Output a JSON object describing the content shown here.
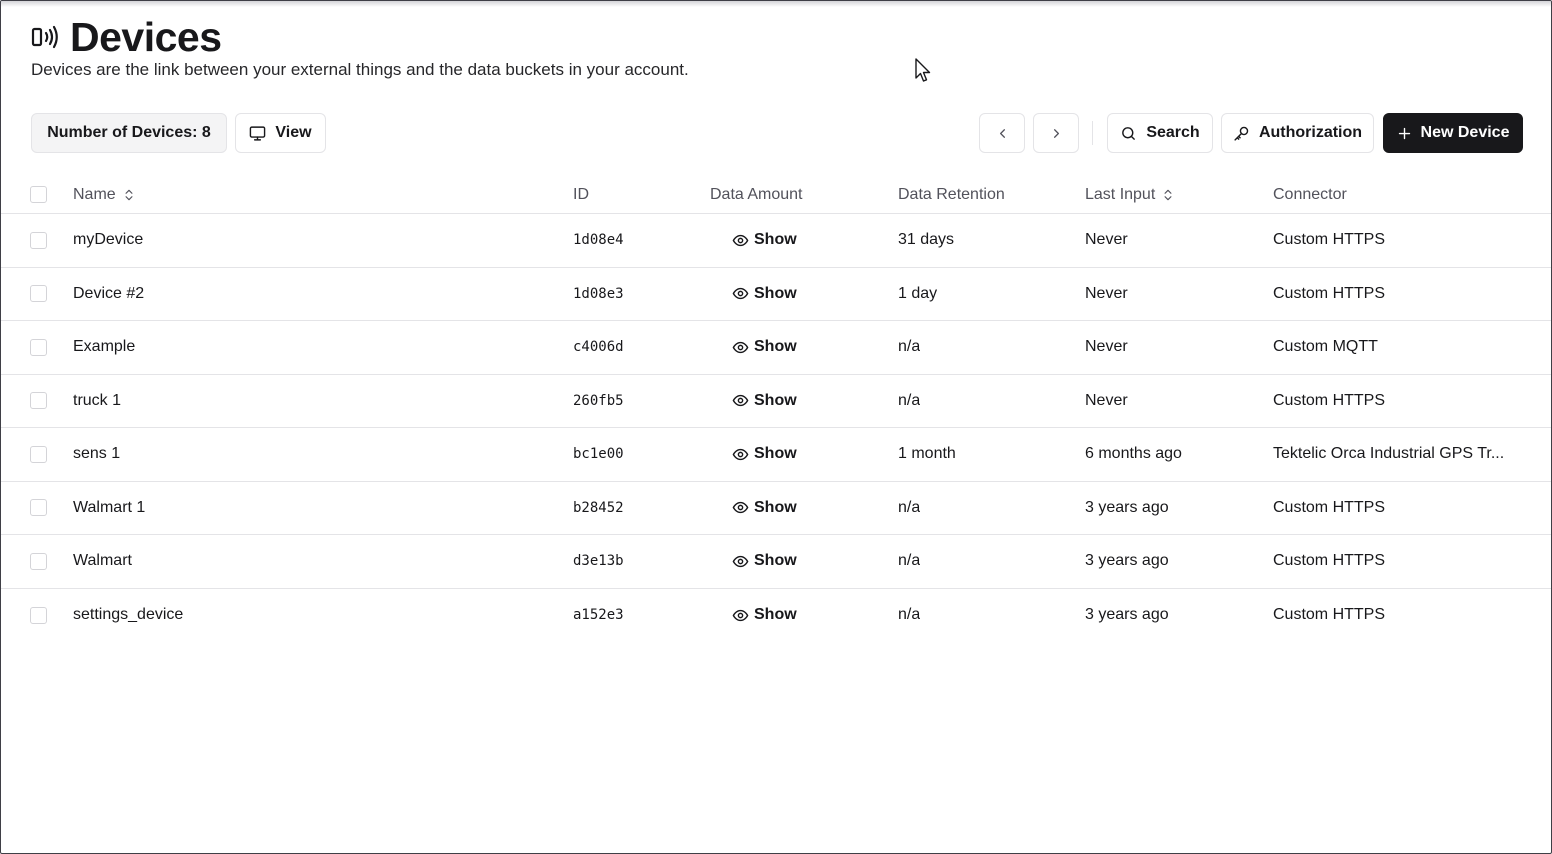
{
  "page": {
    "title": "Devices",
    "subtitle": "Devices are the link between your external things and the data buckets in your account.",
    "title_icon": "device-signal-icon"
  },
  "toolbar": {
    "count_label": "Number of Devices: 8",
    "view_label": "View",
    "search_label": "Search",
    "authorization_label": "Authorization",
    "new_device_label": "New Device"
  },
  "table": {
    "columns": {
      "name": "Name",
      "id": "ID",
      "amount": "Data Amount",
      "retention": "Data Retention",
      "last": "Last Input",
      "connector": "Connector"
    },
    "show_label": "Show",
    "rows": [
      {
        "name": "myDevice",
        "id": "1d08e4",
        "retention": "31 days",
        "last": "Never",
        "connector": "Custom HTTPS"
      },
      {
        "name": "Device #2",
        "id": "1d08e3",
        "retention": "1 day",
        "last": "Never",
        "connector": "Custom HTTPS"
      },
      {
        "name": "Example",
        "id": "c4006d",
        "retention": "n/a",
        "last": "Never",
        "connector": "Custom MQTT"
      },
      {
        "name": "truck 1",
        "id": "260fb5",
        "retention": "n/a",
        "last": "Never",
        "connector": "Custom HTTPS"
      },
      {
        "name": "sens 1",
        "id": "bc1e00",
        "retention": "1 month",
        "last": "6 months ago",
        "connector": "Tektelic Orca Industrial GPS Tr..."
      },
      {
        "name": "Walmart 1",
        "id": "b28452",
        "retention": "n/a",
        "last": "3 years ago",
        "connector": "Custom HTTPS"
      },
      {
        "name": "Walmart",
        "id": "d3e13b",
        "retention": "n/a",
        "last": "3 years ago",
        "connector": "Custom HTTPS"
      },
      {
        "name": "settings_device",
        "id": "a152e3",
        "retention": "n/a",
        "last": "3 years ago",
        "connector": "Custom HTTPS"
      }
    ]
  },
  "colors": {
    "primary_button": "#18181b",
    "border": "#e4e4e7",
    "muted_text": "#52525b"
  }
}
